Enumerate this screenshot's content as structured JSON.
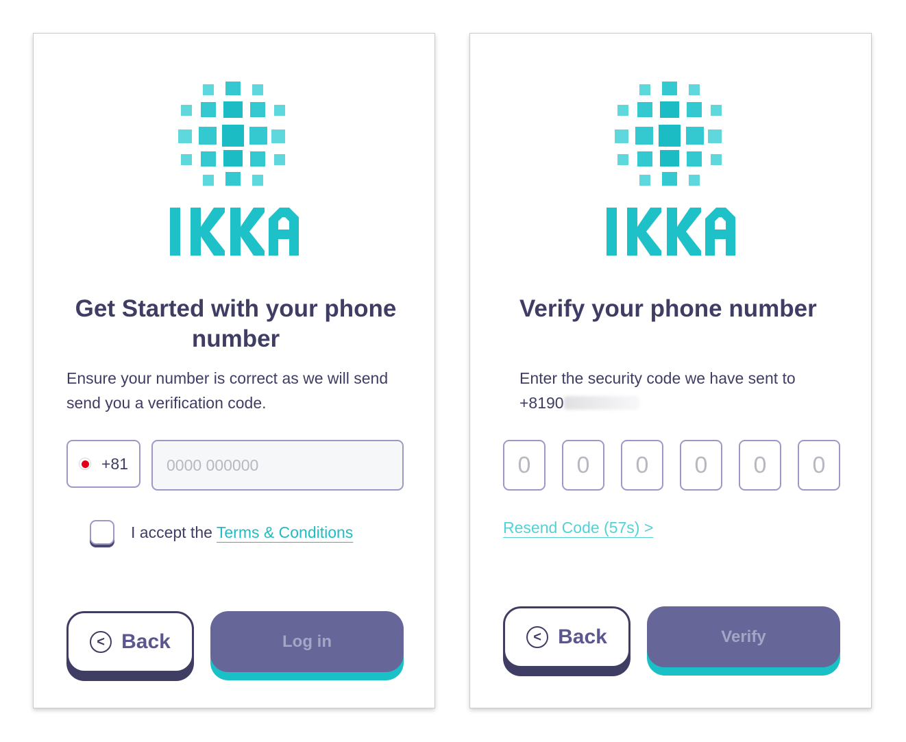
{
  "brand": {
    "name": "IKKA",
    "color_primary": "#1fc1c9",
    "color_light": "#5fd8dd"
  },
  "login": {
    "title": "Get Started with your phone number",
    "description": "Ensure your number is correct as we will send send you a verification code.",
    "country_code": "+81",
    "country_flag": "japan-flag",
    "phone_placeholder": "0000 000000",
    "phone_value": "",
    "terms_prefix": "I accept the ",
    "terms_link": "Terms & Conditions",
    "back_label": "Back",
    "submit_label": "Log in"
  },
  "verify": {
    "title": "Verify your phone number",
    "description_prefix": "Enter the security code we have sent to ",
    "phone_visible": "+8190",
    "otp_placeholders": [
      "0",
      "0",
      "0",
      "0",
      "0",
      "0"
    ],
    "resend_label": "Resend Code (57s) >",
    "back_label": "Back",
    "submit_label": "Verify"
  },
  "colors": {
    "heading": "#3f3d63",
    "border": "#9d97c9",
    "primary_button": "#676698",
    "accent_teal": "#19c0c6"
  }
}
